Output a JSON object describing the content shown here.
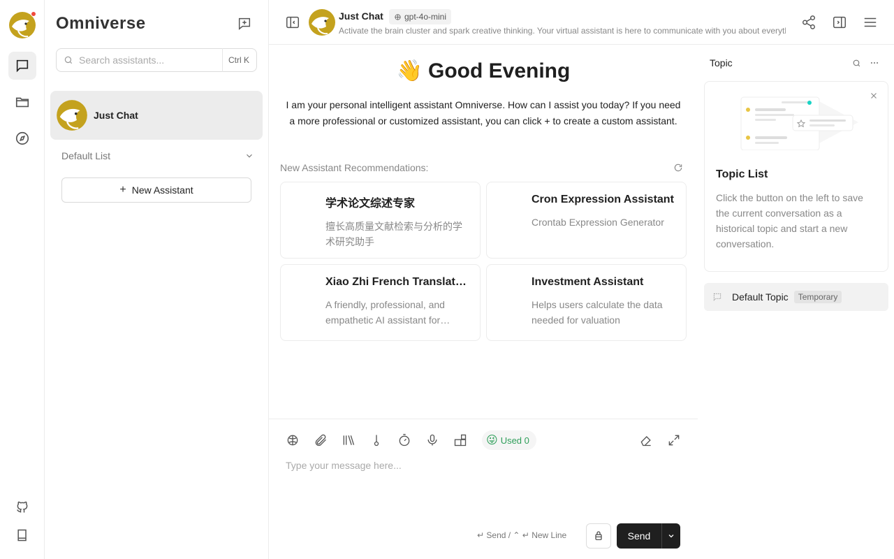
{
  "app": {
    "brand": "Omniverse"
  },
  "sidebar": {
    "search": {
      "placeholder": "Search assistants...",
      "shortcut": "Ctrl K"
    },
    "assistants": [
      {
        "name": "Just Chat"
      }
    ],
    "group": {
      "label": "Default List"
    },
    "new_assistant_label": "New Assistant"
  },
  "header": {
    "title": "Just Chat",
    "model": "gpt-4o-mini",
    "description": "Activate the brain cluster and spark creative thinking. Your virtual assistant is here to communicate with you about everything."
  },
  "welcome": {
    "greeting_emoji": "👋",
    "greeting": "Good Evening",
    "intro": "I am your personal intelligent assistant Omniverse. How can I assist you today? If you need a more professional or customized assistant, you can click + to create a custom assistant.",
    "recommend_label": "New Assistant Recommendations:",
    "cards": [
      {
        "title": "学术论文综述专家",
        "desc": "擅长高质量文献检索与分析的学术研究助手"
      },
      {
        "title": "Cron Expression Assistant",
        "desc": "Crontab Expression Generator"
      },
      {
        "title": "Xiao Zhi French Translation Assistant",
        "desc": "A friendly, professional, and empathetic AI assistant for French translation"
      },
      {
        "title": "Investment Assistant",
        "desc": "Helps users calculate the data needed for valuation"
      }
    ]
  },
  "composer": {
    "used_label": "Used 0",
    "used_emoji": "😜",
    "placeholder": "Type your message here...",
    "hint_send": "↵ Send / ",
    "hint_newline": "⌃ ↵ New Line",
    "send_label": "Send"
  },
  "topics": {
    "header": "Topic",
    "card_title": "Topic List",
    "card_desc": "Click the button on the left to save the current conversation as a historical topic and start a new conversation.",
    "items": [
      {
        "name": "Default Topic",
        "tag": "Temporary"
      }
    ]
  },
  "colors": {
    "accent": "#c4a21e",
    "badge": "#f04a3c",
    "send": "#1f1f1f",
    "used_text": "#2e9e59"
  },
  "icons": [
    "chat-icon",
    "folder-icon",
    "compass-icon",
    "github-icon",
    "book-icon",
    "add-topic-icon",
    "search-icon",
    "chevron-down-icon",
    "plus-icon",
    "sidebar-toggle-icon",
    "share-icon",
    "panel-right-icon",
    "menu-icon",
    "brain-icon",
    "paperclip-icon",
    "library-icon",
    "thermometer-icon",
    "timer-icon",
    "microphone-icon",
    "plugin-icon",
    "eraser-icon",
    "expand-icon",
    "refresh-icon",
    "close-icon",
    "more-icon",
    "topic-icon"
  ]
}
